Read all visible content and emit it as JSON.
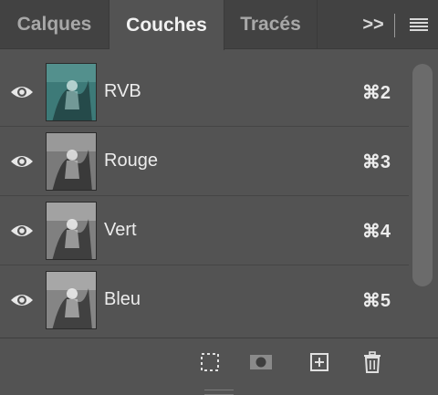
{
  "panel": {
    "tabs": [
      {
        "label": "Calques",
        "active": false
      },
      {
        "label": "Couches",
        "active": true
      },
      {
        "label": "Tracés",
        "active": false
      }
    ],
    "overflow_label": ">>",
    "menu_icon": "hamburger-menu-icon"
  },
  "channels": [
    {
      "name": "RVB",
      "shortcut": "⌘2",
      "visible": true,
      "thumbnail": "color"
    },
    {
      "name": "Rouge",
      "shortcut": "⌘3",
      "visible": true,
      "thumbnail": "grayscale"
    },
    {
      "name": "Vert",
      "shortcut": "⌘4",
      "visible": true,
      "thumbnail": "grayscale"
    },
    {
      "name": "Bleu",
      "shortcut": "⌘5",
      "visible": true,
      "thumbnail": "grayscale"
    }
  ],
  "footer": {
    "icons": [
      "selection-from-channel-icon",
      "save-selection-as-channel-icon",
      "new-channel-icon",
      "delete-channel-icon"
    ]
  },
  "colors": {
    "panel_bg": "#535353",
    "tabbar_bg": "#424242",
    "rgb_thumb_tint": "#3d7a78"
  }
}
